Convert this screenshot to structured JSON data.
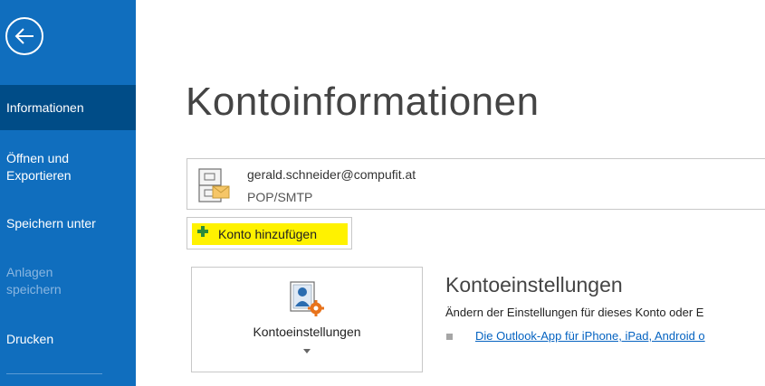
{
  "sidebar": {
    "items": [
      {
        "label": "Informationen",
        "active": true,
        "disabled": false
      },
      {
        "label": "Öffnen und Exportieren",
        "active": false,
        "disabled": false
      },
      {
        "label": "Speichern unter",
        "active": false,
        "disabled": false
      },
      {
        "label": "Anlagen speichern",
        "active": false,
        "disabled": true
      },
      {
        "label": "Drucken",
        "active": false,
        "disabled": false
      }
    ]
  },
  "main": {
    "title": "Kontoinformationen",
    "account": {
      "email": "gerald.schneider@compufit.at",
      "type": "POP/SMTP"
    },
    "add_account_label": "Konto hinzufügen",
    "settings_tile_label": "Kontoeinstellungen",
    "settings_section": {
      "title": "Kontoeinstellungen",
      "description": "Ändern der Einstellungen für dieses Konto oder E",
      "link": "Die Outlook-App für iPhone, iPad, Android o"
    }
  },
  "colors": {
    "sidebar_bg": "#106ebe",
    "sidebar_active": "#004c87",
    "highlight": "#fff200",
    "link": "#0563c1"
  },
  "icons": {
    "back": "back-arrow-icon",
    "account": "mail-cabinet-icon",
    "add": "plus-icon",
    "settings": "account-settings-icon",
    "dropdown": "chevron-down-icon",
    "bullet": "square-bullet-icon"
  }
}
